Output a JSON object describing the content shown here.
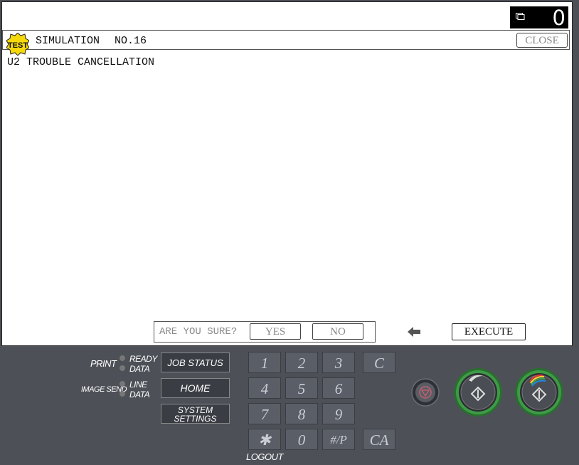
{
  "counter": {
    "icon": "copy-icon",
    "value": "0"
  },
  "simulation": {
    "badge": "TEST",
    "title": "SIMULATION",
    "number": "NO.16",
    "close_label": "CLOSE",
    "subtitle": "U2 TROUBLE CANCELLATION"
  },
  "confirm": {
    "question": "ARE YOU SURE?",
    "yes_label": "YES",
    "no_label": "NO"
  },
  "execute_label": "EXECUTE",
  "status": {
    "print_label": "PRINT",
    "print_ready": "READY",
    "print_data": "DATA",
    "image_send_label": "IMAGE SEND",
    "send_line": "LINE",
    "send_data": "DATA"
  },
  "panel_buttons": {
    "job_status": "JOB STATUS",
    "home": "HOME",
    "system_settings_1": "SYSTEM",
    "system_settings_2": "SETTINGS"
  },
  "keypad": [
    "1",
    "2",
    "3",
    "C",
    "4",
    "5",
    "6",
    "7",
    "8",
    "9",
    "✱",
    "0",
    "#/P",
    "CA"
  ],
  "logout_label": "LOGOUT",
  "colors": {
    "panel_bg": "#4d5057",
    "key_bg": "#5a5e67",
    "start_ring": "#3d9b45",
    "badge_yellow": "#f5d90a"
  }
}
